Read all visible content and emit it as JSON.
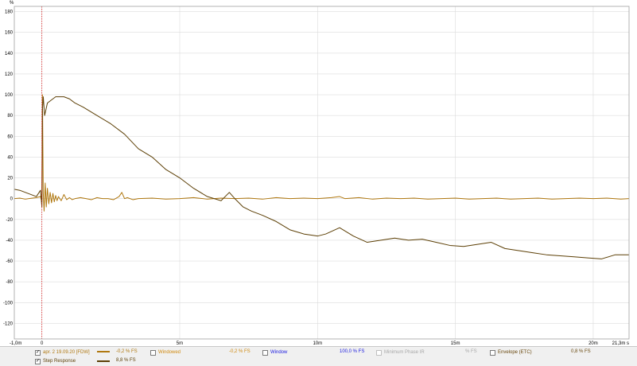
{
  "chart_data": {
    "type": "line",
    "y_unit": "%",
    "x_unit": "s",
    "xlim": [
      -1.0,
      21.3
    ],
    "ylim": [
      -135,
      185
    ],
    "x_ticks": [
      {
        "v": -1.0,
        "label": "-1,0m"
      },
      {
        "v": 0,
        "label": "0"
      },
      {
        "v": 5,
        "label": "5m"
      },
      {
        "v": 10,
        "label": "10m"
      },
      {
        "v": 15,
        "label": "15m"
      },
      {
        "v": 20,
        "label": "20m"
      },
      {
        "v": 21.3,
        "label": "21,3m s"
      }
    ],
    "y_ticks": [
      180,
      160,
      140,
      120,
      100,
      80,
      60,
      40,
      20,
      0,
      -20,
      -40,
      -60,
      -80,
      -100,
      -120
    ],
    "grid": true,
    "cursor_x": 0,
    "series": [
      {
        "name": "apr. 2 19.09.20 [FDW]",
        "color": "#b07810",
        "x": [
          -1.0,
          -0.8,
          -0.6,
          -0.4,
          -0.2,
          -0.05,
          0,
          0.02,
          0.05,
          0.08,
          0.12,
          0.16,
          0.2,
          0.25,
          0.3,
          0.35,
          0.4,
          0.45,
          0.5,
          0.55,
          0.6,
          0.7,
          0.8,
          0.9,
          1.0,
          1.1,
          1.2,
          1.4,
          1.6,
          1.8,
          2.0,
          2.2,
          2.4,
          2.6,
          2.8,
          2.9,
          3.0,
          3.1,
          3.3,
          3.5,
          4.0,
          4.5,
          5.0,
          5.5,
          6.0,
          6.5,
          7.0,
          7.5,
          8.0,
          8.5,
          9.0,
          9.5,
          10.0,
          10.5,
          10.8,
          11.0,
          11.5,
          12.0,
          12.5,
          13.0,
          13.5,
          14.0,
          14.5,
          15.0,
          15.5,
          16.0,
          16.5,
          17.0,
          17.5,
          18.0,
          18.5,
          19.0,
          19.5,
          20.0,
          20.5,
          21.0,
          21.3
        ],
        "y": [
          0,
          0.5,
          -0.5,
          0.3,
          1,
          2,
          -3,
          100,
          5,
          -12,
          15,
          -8,
          10,
          -5,
          6,
          -4,
          5,
          -3,
          3,
          -2,
          2,
          -2,
          4,
          -1,
          1,
          -1,
          0,
          1,
          0,
          -1,
          1,
          0,
          0,
          -1,
          2,
          6,
          0,
          1,
          -1,
          0,
          0.5,
          -0.5,
          0,
          1,
          -0.5,
          0.5,
          0,
          0.5,
          -0.5,
          1,
          0,
          0.5,
          0,
          1,
          2,
          0,
          1,
          -0.5,
          0.5,
          0,
          0.5,
          -0.5,
          0,
          0.5,
          -0.5,
          0,
          0.5,
          -0.5,
          0,
          0.5,
          -0.5,
          0,
          0.5,
          0,
          0.5,
          -0.5,
          0
        ]
      },
      {
        "name": "Step Response",
        "color": "#5c3f05",
        "x": [
          -1.0,
          -0.8,
          -0.6,
          -0.4,
          -0.2,
          -0.05,
          0,
          0.02,
          0.05,
          0.1,
          0.2,
          0.3,
          0.5,
          0.8,
          1.0,
          1.2,
          1.5,
          2.0,
          2.5,
          3.0,
          3.5,
          4.0,
          4.5,
          5.0,
          5.5,
          6.0,
          6.5,
          6.8,
          7.0,
          7.3,
          7.6,
          8.0,
          8.5,
          9.0,
          9.5,
          10.0,
          10.3,
          10.8,
          11.3,
          11.8,
          12.3,
          12.8,
          13.3,
          13.8,
          14.3,
          14.8,
          15.3,
          15.8,
          16.3,
          16.8,
          17.3,
          17.8,
          18.3,
          18.8,
          19.3,
          19.8,
          20.3,
          20.8,
          21.3
        ],
        "y": [
          9,
          8,
          6,
          4,
          2,
          8,
          -8,
          85,
          98,
          80,
          92,
          94,
          98,
          98,
          96,
          92,
          88,
          80,
          72,
          62,
          48,
          40,
          28,
          20,
          10,
          2,
          -2,
          6,
          0,
          -8,
          -12,
          -16,
          -22,
          -30,
          -34,
          -36,
          -34,
          -28,
          -36,
          -42,
          -40,
          -38,
          -40,
          -39,
          -42,
          -45,
          -46,
          -44,
          -42,
          -48,
          -50,
          -52,
          -54,
          -55,
          -56,
          -57,
          -58,
          -54,
          -54
        ]
      }
    ],
    "legend": {
      "items": [
        {
          "label": "apr. 2 19.09.20 [FDW]",
          "value": "-0,2 % FS",
          "checked": true,
          "color": "#b07810"
        },
        {
          "label": "Windowed",
          "value": "-0,2 % FS",
          "checked": false,
          "color": "#d08a10"
        },
        {
          "label": "Window",
          "value": "100,0 % FS",
          "checked": false,
          "color": "#2020e0"
        },
        {
          "label": "Minimum Phase IR",
          "value": "% FS",
          "checked": false,
          "color": "#a8a8a8"
        },
        {
          "label": "Envelope (ETC)",
          "value": "0,8 % FS",
          "checked": false,
          "color": "#6a4a10"
        },
        {
          "label": "Step Response",
          "value": "8,8 % FS",
          "checked": true,
          "color": "#5c3f05"
        }
      ]
    }
  }
}
